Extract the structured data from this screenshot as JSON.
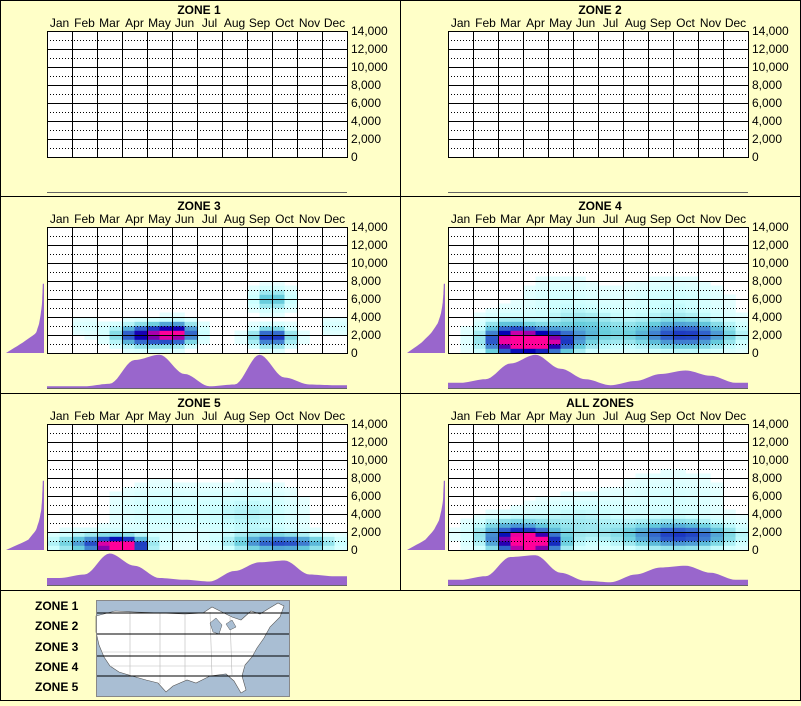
{
  "months": [
    "Jan",
    "Feb",
    "Mar",
    "Apr",
    "May",
    "Jun",
    "Jul",
    "Aug",
    "Sep",
    "Oct",
    "Nov",
    "Dec"
  ],
  "y_ticks": [
    "14,000",
    "12,000",
    "10,000",
    "8,000",
    "6,000",
    "4,000",
    "2,000",
    "0"
  ],
  "colors": {
    "background": "#ffffc8",
    "profile_fill": "#9966cc",
    "heat_light": "#ccffff",
    "heat_mid": "#66cccc",
    "heat_dark": "#0000cc",
    "heat_peak": "#ff0099"
  },
  "chart_data": [
    {
      "type": "heatmap",
      "title": "ZONE 1",
      "x_categories": [
        "Jan",
        "Feb",
        "Mar",
        "Apr",
        "May",
        "Jun",
        "Jul",
        "Aug",
        "Sep",
        "Oct",
        "Nov",
        "Dec"
      ],
      "ylim": [
        0,
        14000
      ],
      "blobs": [],
      "monthly_profile": [],
      "elevation_profile": []
    },
    {
      "type": "heatmap",
      "title": "ZONE 2",
      "x_categories": [
        "Jan",
        "Feb",
        "Mar",
        "Apr",
        "May",
        "Jun",
        "Jul",
        "Aug",
        "Sep",
        "Oct",
        "Nov",
        "Dec"
      ],
      "ylim": [
        0,
        14000
      ],
      "blobs": [],
      "monthly_profile": [],
      "elevation_profile": []
    },
    {
      "type": "heatmap",
      "title": "ZONE 3",
      "x_categories": [
        "Jan",
        "Feb",
        "Mar",
        "Apr",
        "May",
        "Jun",
        "Jul",
        "Aug",
        "Sep",
        "Oct",
        "Nov",
        "Dec"
      ],
      "ylim": [
        0,
        14000
      ],
      "blobs": [
        {
          "month": 3.8,
          "elev": 2000,
          "month_sigma": 0.8,
          "elev_sigma": 900,
          "intensity": 0.8
        },
        {
          "month": 5.2,
          "elev": 2200,
          "month_sigma": 0.6,
          "elev_sigma": 900,
          "intensity": 0.85
        },
        {
          "month": 9.0,
          "elev": 1800,
          "month_sigma": 0.6,
          "elev_sigma": 800,
          "intensity": 0.75
        },
        {
          "month": 9.0,
          "elev": 6000,
          "month_sigma": 0.6,
          "elev_sigma": 900,
          "intensity": 0.45
        },
        {
          "month": 11.5,
          "elev": 3000,
          "month_sigma": 0.5,
          "elev_sigma": 900,
          "intensity": 0.15
        },
        {
          "month": 1.5,
          "elev": 3000,
          "month_sigma": 0.6,
          "elev_sigma": 800,
          "intensity": 0.12
        }
      ],
      "monthly_profile": [
        0.05,
        0.05,
        0.12,
        0.8,
        0.95,
        0.4,
        0.05,
        0.1,
        0.95,
        0.3,
        0.1,
        0.08
      ],
      "elevation_profile": [
        0.95,
        0.55,
        0.2,
        0.12,
        0.08,
        0.05,
        0.04,
        0.03
      ]
    },
    {
      "type": "heatmap",
      "title": "ZONE 4",
      "x_categories": [
        "Jan",
        "Feb",
        "Mar",
        "Apr",
        "May",
        "Jun",
        "Jul",
        "Aug",
        "Sep",
        "Oct",
        "Nov",
        "Dec"
      ],
      "ylim": [
        0,
        14000
      ],
      "blobs": [
        {
          "month": 3.5,
          "elev": 1200,
          "month_sigma": 1.0,
          "elev_sigma": 1000,
          "intensity": 1.0
        },
        {
          "month": 2.3,
          "elev": 1800,
          "month_sigma": 0.8,
          "elev_sigma": 1500,
          "intensity": 0.55
        },
        {
          "month": 5.5,
          "elev": 2500,
          "month_sigma": 1.2,
          "elev_sigma": 1600,
          "intensity": 0.35
        },
        {
          "month": 9.5,
          "elev": 2000,
          "month_sigma": 1.6,
          "elev_sigma": 1200,
          "intensity": 0.65
        },
        {
          "month": 9.0,
          "elev": 5500,
          "month_sigma": 1.5,
          "elev_sigma": 2000,
          "intensity": 0.2
        },
        {
          "month": 4.5,
          "elev": 6000,
          "month_sigma": 1.2,
          "elev_sigma": 2000,
          "intensity": 0.15
        }
      ],
      "monthly_profile": [
        0.15,
        0.25,
        0.7,
        0.95,
        0.55,
        0.25,
        0.08,
        0.2,
        0.4,
        0.5,
        0.35,
        0.15
      ],
      "elevation_profile": [
        0.95,
        0.6,
        0.35,
        0.18,
        0.1,
        0.06,
        0.04,
        0.03
      ]
    },
    {
      "type": "heatmap",
      "title": "ZONE 5",
      "x_categories": [
        "Jan",
        "Feb",
        "Mar",
        "Apr",
        "May",
        "Jun",
        "Jul",
        "Aug",
        "Sep",
        "Oct",
        "Nov",
        "Dec"
      ],
      "ylim": [
        0,
        14000
      ],
      "blobs": [
        {
          "month": 3.0,
          "elev": 400,
          "month_sigma": 0.6,
          "elev_sigma": 600,
          "intensity": 1.0
        },
        {
          "month": 2.0,
          "elev": 800,
          "month_sigma": 1.4,
          "elev_sigma": 800,
          "intensity": 0.55
        },
        {
          "month": 9.5,
          "elev": 800,
          "month_sigma": 1.5,
          "elev_sigma": 700,
          "intensity": 0.6
        },
        {
          "month": 8.2,
          "elev": 4000,
          "month_sigma": 1.4,
          "elev_sigma": 2200,
          "intensity": 0.25
        },
        {
          "month": 4.5,
          "elev": 4500,
          "month_sigma": 1.5,
          "elev_sigma": 2200,
          "intensity": 0.18
        }
      ],
      "monthly_profile": [
        0.2,
        0.3,
        0.9,
        0.55,
        0.2,
        0.15,
        0.1,
        0.4,
        0.65,
        0.7,
        0.3,
        0.25
      ],
      "elevation_profile": [
        0.95,
        0.4,
        0.2,
        0.12,
        0.07,
        0.05,
        0.04,
        0.03
      ]
    },
    {
      "type": "heatmap",
      "title": "ALL ZONES",
      "x_categories": [
        "Jan",
        "Feb",
        "Mar",
        "Apr",
        "May",
        "Jun",
        "Jul",
        "Aug",
        "Sep",
        "Oct",
        "Nov",
        "Dec"
      ],
      "ylim": [
        0,
        14000
      ],
      "blobs": [
        {
          "month": 3.3,
          "elev": 800,
          "month_sigma": 0.8,
          "elev_sigma": 800,
          "intensity": 1.0
        },
        {
          "month": 2.5,
          "elev": 1800,
          "month_sigma": 1.1,
          "elev_sigma": 1300,
          "intensity": 0.55
        },
        {
          "month": 9.3,
          "elev": 1600,
          "month_sigma": 1.7,
          "elev_sigma": 1100,
          "intensity": 0.65
        },
        {
          "month": 5.2,
          "elev": 3000,
          "month_sigma": 1.4,
          "elev_sigma": 2000,
          "intensity": 0.25
        },
        {
          "month": 9.0,
          "elev": 5500,
          "month_sigma": 1.6,
          "elev_sigma": 2500,
          "intensity": 0.15
        }
      ],
      "monthly_profile": [
        0.15,
        0.25,
        0.8,
        0.85,
        0.35,
        0.12,
        0.08,
        0.3,
        0.5,
        0.55,
        0.35,
        0.15
      ],
      "elevation_profile": [
        0.95,
        0.5,
        0.28,
        0.15,
        0.09,
        0.05,
        0.04,
        0.03
      ]
    }
  ],
  "legend": {
    "zones": [
      "ZONE 1",
      "ZONE 2",
      "ZONE 3",
      "ZONE 4",
      "ZONE 5"
    ]
  }
}
